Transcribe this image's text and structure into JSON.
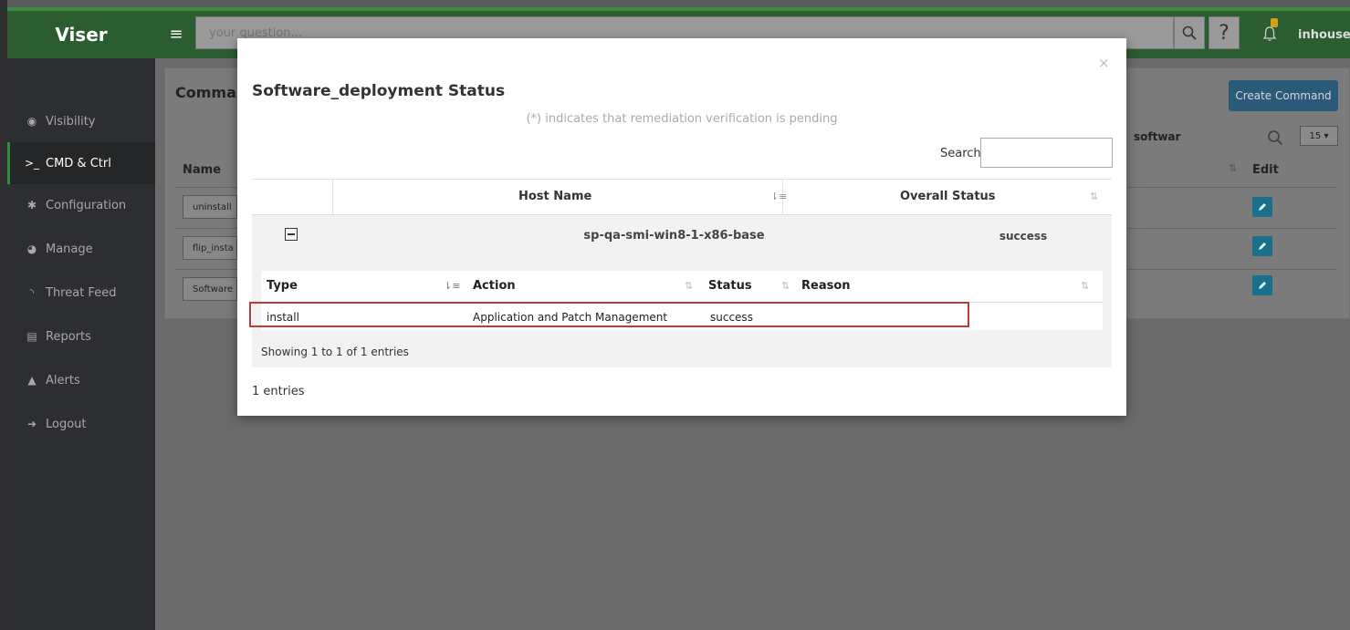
{
  "app": {
    "brand": "Viser",
    "username": "inhouse"
  },
  "topbar": {
    "search_placeholder": "your question..."
  },
  "sidebar": {
    "items": [
      {
        "label": "Visibility",
        "icon": "eye-icon"
      },
      {
        "label": "CMD & Ctrl",
        "icon": "terminal-icon",
        "active": true
      },
      {
        "label": "Configuration",
        "icon": "gear-icon"
      },
      {
        "label": "Manage",
        "icon": "pie-chart-icon"
      },
      {
        "label": "Threat Feed",
        "icon": "rss-icon"
      },
      {
        "label": "Reports",
        "icon": "report-icon"
      },
      {
        "label": "Alerts",
        "icon": "warning-icon"
      },
      {
        "label": "Logout",
        "icon": "logout-icon"
      }
    ]
  },
  "background": {
    "panel_title": "Comma",
    "create_button": "Create Command",
    "search_value": "softwar",
    "page_size": "15",
    "col_name": "Name",
    "col_edit": "Edit",
    "rows": [
      "uninstall",
      "flip_insta",
      "Software"
    ]
  },
  "modal": {
    "title": "Software_deployment Status",
    "close": "×",
    "note": "(*) indicates that remediation verification is pending",
    "search_label": "Search:",
    "col_host": "Host Name",
    "col_overall": "Overall Status",
    "host_name": "sp-qa-smi-win8-1-x86-base",
    "overall_status": "success",
    "inner": {
      "col_type": "Type",
      "col_action": "Action",
      "col_status": "Status",
      "col_reason": "Reason",
      "row": {
        "type": "install",
        "action": "Application and Patch Management",
        "status": "success",
        "reason": ""
      },
      "showing": "Showing 1 to 1 of 1 entries"
    },
    "entries": "1 entries"
  },
  "colors": {
    "topbar": "#2b5d30",
    "sidebar": "#2c2e31",
    "highlight": "#c0393b",
    "accent": "#2f8f3a"
  }
}
